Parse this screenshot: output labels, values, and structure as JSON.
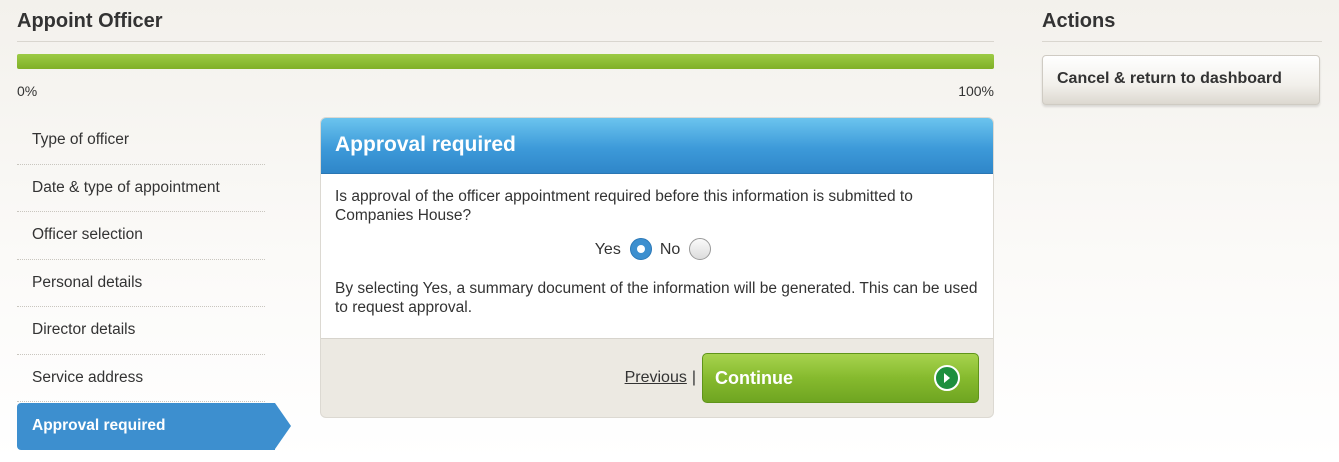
{
  "main": {
    "title": "Appoint Officer",
    "progress": {
      "percent": 100,
      "min_label": "0%",
      "max_label": "100%"
    }
  },
  "steps": [
    {
      "label": "Type of officer"
    },
    {
      "label": "Date & type of appointment"
    },
    {
      "label": "Officer selection"
    },
    {
      "label": "Personal details"
    },
    {
      "label": "Director details"
    },
    {
      "label": "Service address"
    },
    {
      "label": "Approval required",
      "active": true
    }
  ],
  "panel": {
    "title": "Approval required",
    "question": "Is approval of the officer appointment required before this information is submitted to Companies House?",
    "options": {
      "yes": "Yes",
      "no": "No",
      "selected": "Yes"
    },
    "note": "By selecting Yes, a summary document of the information will be generated. This can be used to request approval.",
    "previous_label": "Previous",
    "separator": "|",
    "continue_label": "Continue"
  },
  "actions": {
    "title": "Actions",
    "cancel_label": "Cancel & return to dashboard"
  },
  "colors": {
    "progress": "#80b027",
    "active_step": "#3d8fcf",
    "panel_header": "#3d9ad9",
    "continue_button": "#86ba2e",
    "continue_icon": "#1d8f3d"
  },
  "icons": {
    "continue": "play-circle-icon"
  }
}
